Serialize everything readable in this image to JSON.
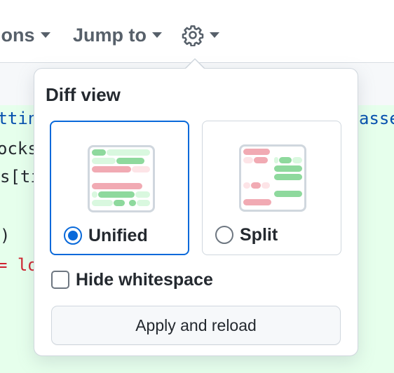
{
  "toolbar": {
    "options_label": "ions",
    "jump_label": "Jump to"
  },
  "code": {
    "lines": [
      "uttin",
      "ocks",
      "s[ti",
      ")",
      "= lo"
    ],
    "right_fragment": "asse"
  },
  "diff_view": {
    "title": "Diff view",
    "options": [
      {
        "label": "Unified",
        "selected": true
      },
      {
        "label": "Split",
        "selected": false
      }
    ],
    "hide_whitespace_label": "Hide whitespace",
    "hide_whitespace_checked": false,
    "apply_label": "Apply and reload"
  },
  "colors": {
    "accent": "#0969da",
    "added": "#8ed99d",
    "removed": "#f1aab3",
    "added_bg": "#e6ffec"
  }
}
